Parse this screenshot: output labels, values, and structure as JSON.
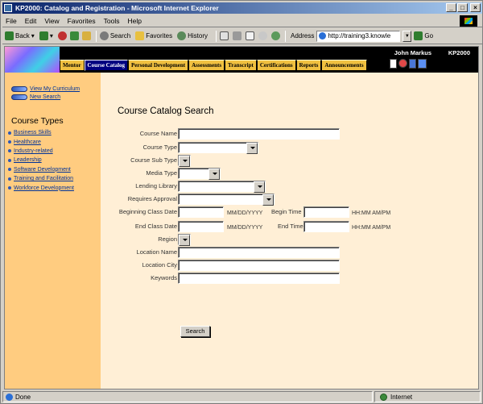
{
  "window": {
    "title": "KP2000: Catalog and Registration - Microsoft Internet Explorer",
    "min": "_",
    "max": "□",
    "close": "×"
  },
  "menu": [
    "File",
    "Edit",
    "View",
    "Favorites",
    "Tools",
    "Help"
  ],
  "toolbar": {
    "back": "Back",
    "search": "Search",
    "favorites": "Favorites",
    "history": "History",
    "address_label": "Address",
    "address_value": "http://training3.knowle",
    "go": "Go"
  },
  "banner": {
    "user": "John Markus",
    "app": "KP2000"
  },
  "nav_tabs": [
    "Mentor",
    "Course Catalog",
    "Personal Development",
    "Assessments",
    "Transcript",
    "Certifications",
    "Reports",
    "Announcements"
  ],
  "sidebar": {
    "links": [
      "View My Curriculum",
      "New Search"
    ],
    "heading": "Course Types",
    "course_types": [
      "Business Skills",
      "Healthcare",
      "Industry-related",
      "Leadership",
      "Software Development",
      "Training and Facilitation",
      "Workforce Development"
    ]
  },
  "form": {
    "title": "Course Catalog Search",
    "course_name": "Course Name",
    "course_type": "Course Type",
    "course_sub_type": "Course Sub Type",
    "media_type": "Media Type",
    "lending_library": "Lending Library",
    "requires_approval": "Requires Approval",
    "beginning_class_date": "Beginning Class Date",
    "end_class_date": "End Class Date",
    "date_hint": "MM/DD/YYYY",
    "begin_time": "Begin Time",
    "end_time": "End Time",
    "time_hint": "HH:MM AM/PM",
    "region": "Region",
    "location_name": "Location Name",
    "location_city": "Location City",
    "keywords": "Keywords",
    "search_button": "Search"
  },
  "status": {
    "left": "Done",
    "zone": "Internet"
  }
}
